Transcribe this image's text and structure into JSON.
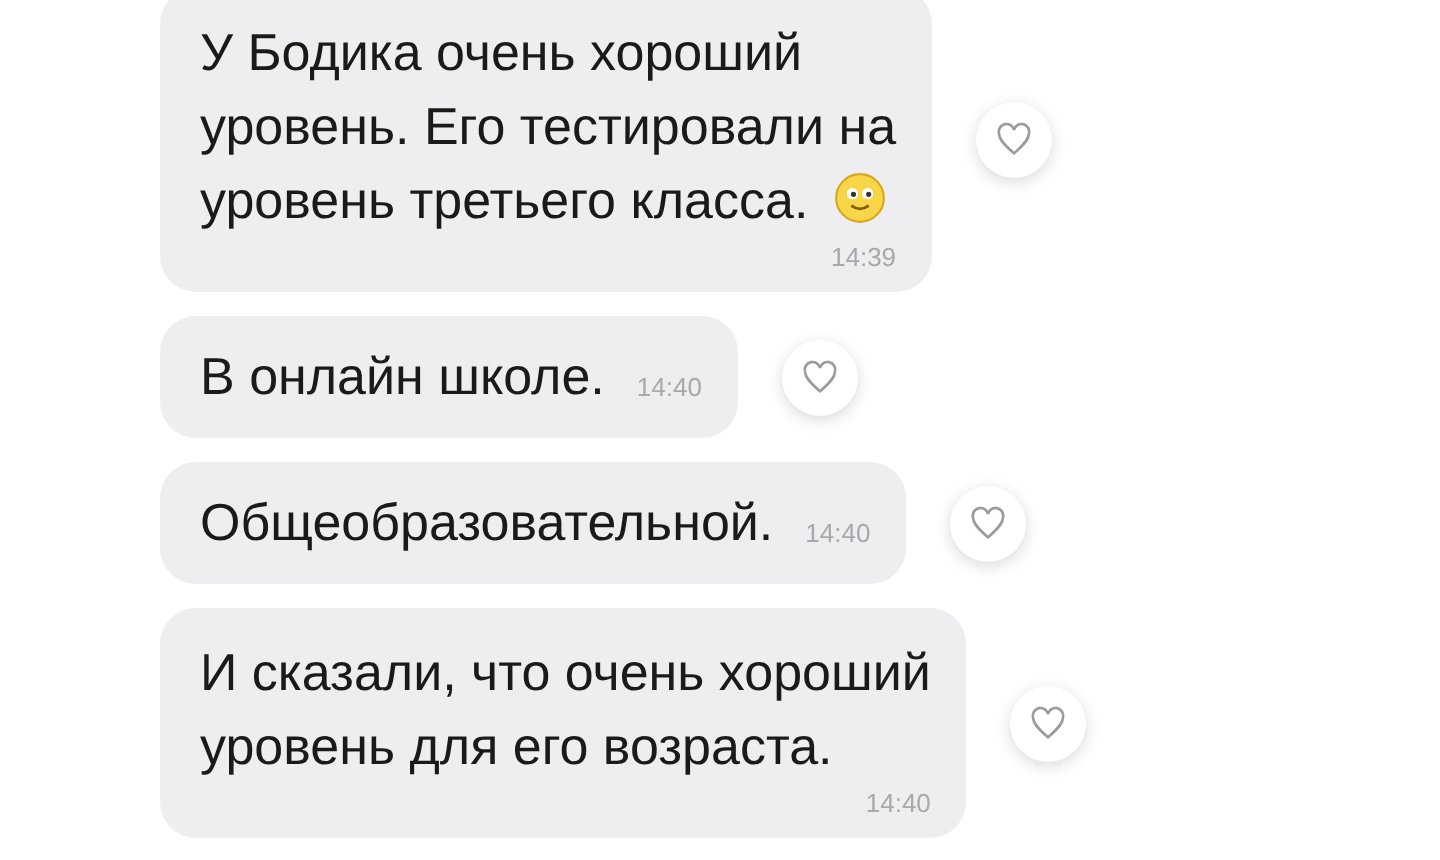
{
  "messages": [
    {
      "text": "У Бодика очень хороший\nуровень. Его тестировали на\nуровень третьего класса.",
      "has_emoji": true,
      "kind": "block",
      "time": "14:39"
    },
    {
      "text": "В онлайн школе.",
      "has_emoji": false,
      "kind": "inline",
      "time": "14:40"
    },
    {
      "text": "Общеобразовательной.",
      "has_emoji": false,
      "kind": "inline",
      "time": "14:40"
    },
    {
      "text": "И сказали, что очень хороший\nуровень для его возраста.",
      "has_emoji": false,
      "kind": "block",
      "time": "14:40"
    }
  ]
}
